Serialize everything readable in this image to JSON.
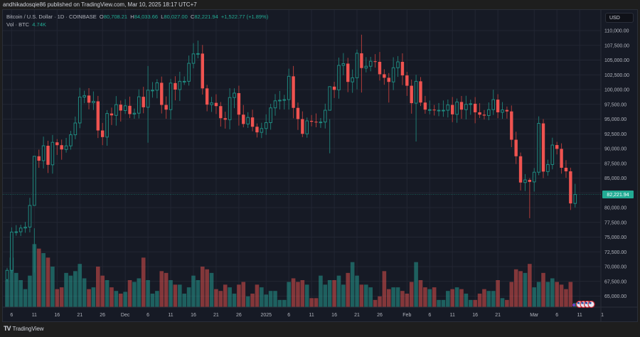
{
  "header": {
    "published": "andhikadosqie86 published on TradingView.com, Mar 10, 2025 18:17 UTC+7"
  },
  "legend": {
    "symbol": "Bitcoin / U.S. Dollar · 1D · COINBASE",
    "o_label": "O",
    "o": "80,708.21",
    "h_label": "H",
    "h": "84,033.66",
    "l_label": "L",
    "l": "80,027.00",
    "c_label": "C",
    "c": "82,221.94",
    "change": "+1,522.77 (+1.89%)",
    "vol_label": "Vol · BTC",
    "vol": "4.74K"
  },
  "currency_button": "USD",
  "last_price_label": "82,221.94",
  "footer": {
    "logo": "TradingView"
  },
  "colors": {
    "up": "#26a69a",
    "down": "#ef5350",
    "bg": "#161a25",
    "last": "#22ab94"
  },
  "price_ticks": [
    "110,000.00",
    "107,500.00",
    "105,000.00",
    "102,500.00",
    "100,000.00",
    "97,500.00",
    "95,000.00",
    "92,500.00",
    "90,000.00",
    "87,500.00",
    "85,000.00",
    "82,500.00",
    "80,000.00",
    "77,500.00",
    "75,000.00",
    "72,500.00",
    "70,000.00",
    "67,500.00",
    "65,000.00"
  ],
  "price_tick_values": [
    110000,
    107500,
    105000,
    102500,
    100000,
    97500,
    95000,
    92500,
    90000,
    87500,
    85000,
    82500,
    80000,
    77500,
    75000,
    72500,
    70000,
    67500,
    65000
  ],
  "time_labels": [
    {
      "text": "6",
      "day": 1
    },
    {
      "text": "11",
      "day": 6
    },
    {
      "text": "16",
      "day": 11
    },
    {
      "text": "21",
      "day": 16
    },
    {
      "text": "26",
      "day": 21
    },
    {
      "text": "Dec",
      "day": 26
    },
    {
      "text": "6",
      "day": 31
    },
    {
      "text": "11",
      "day": 36
    },
    {
      "text": "16",
      "day": 41
    },
    {
      "text": "21",
      "day": 46
    },
    {
      "text": "26",
      "day": 51
    },
    {
      "text": "2025",
      "day": 57
    },
    {
      "text": "6",
      "day": 62
    },
    {
      "text": "11",
      "day": 67
    },
    {
      "text": "16",
      "day": 72
    },
    {
      "text": "21",
      "day": 77
    },
    {
      "text": "26",
      "day": 82
    },
    {
      "text": "Feb",
      "day": 88
    },
    {
      "text": "6",
      "day": 93
    },
    {
      "text": "11",
      "day": 98
    },
    {
      "text": "16",
      "day": 103
    },
    {
      "text": "21",
      "day": 108
    },
    {
      "text": "Mar",
      "day": 116
    },
    {
      "text": "6",
      "day": 121
    },
    {
      "text": "11",
      "day": 126
    },
    {
      "text": "1",
      "day": 131
    }
  ],
  "chart_data": {
    "type": "candlestick",
    "title": "Bitcoin / U.S. Dollar · 1D · COINBASE",
    "start_date": "2024-11-05",
    "ylim": [
      62500,
      111500
    ],
    "closes": [
      69370,
      75860,
      75900,
      76540,
      76700,
      80370,
      88700,
      87950,
      90480,
      87250,
      91060,
      90580,
      89850,
      90460,
      92340,
      94340,
      98730,
      98990,
      97780,
      98010,
      93070,
      91950,
      95950,
      95630,
      97450,
      96450,
      97250,
      95850,
      96000,
      98780,
      97000,
      99900,
      99900,
      101150,
      97400,
      96600,
      101100,
      100000,
      101400,
      101400,
      104450,
      106050,
      106100,
      100200,
      97450,
      97750,
      97200,
      95150,
      94900,
      98650,
      99400,
      95750,
      94170,
      95280,
      93700,
      92750,
      93400,
      94400,
      96900,
      98100,
      98200,
      98300,
      102250,
      96900,
      95000,
      92500,
      94700,
      94550,
      94500,
      94500,
      96500,
      100500,
      99950,
      104100,
      104400,
      101300,
      102000,
      106150,
      103650,
      103950,
      104800,
      104700,
      102600,
      102000,
      101300,
      103700,
      104700,
      102400,
      100650,
      97700,
      101400,
      97800,
      96600,
      96600,
      96500,
      96500,
      96500,
      97400,
      95800,
      97900,
      96600,
      97500,
      97600,
      96150,
      95750,
      95600,
      96600,
      98300,
      96150,
      96550,
      96300,
      91500,
      88700,
      84250,
      84700,
      84350,
      86000,
      94270,
      86100,
      87300,
      90600,
      89950,
      86750,
      86150,
      80708,
      82221.94
    ],
    "first_open": 67800,
    "extremes": {
      "6": [
        76500,
        69000
      ],
      "31": [
        104000,
        91000
      ],
      "42": [
        108300,
        105300
      ],
      "71": [
        95000,
        89200
      ],
      "78": [
        109300,
        99500
      ],
      "84": [
        102800,
        97800
      ],
      "90": [
        102500,
        91200
      ],
      "115": [
        85000,
        78200
      ],
      "118": [
        95000,
        85000
      ],
      "125": [
        84033.66,
        80027
      ]
    },
    "volumes_k": [
      30,
      55,
      38,
      30,
      20,
      35,
      70,
      65,
      60,
      55,
      45,
      20,
      22,
      38,
      35,
      40,
      48,
      32,
      20,
      22,
      45,
      35,
      30,
      22,
      18,
      15,
      17,
      30,
      28,
      32,
      55,
      30,
      15,
      18,
      40,
      38,
      30,
      25,
      25,
      15,
      22,
      35,
      30,
      45,
      42,
      38,
      20,
      18,
      25,
      22,
      15,
      25,
      28,
      12,
      15,
      25,
      22,
      14,
      18,
      18,
      8,
      8,
      28,
      32,
      28,
      30,
      25,
      10,
      10,
      35,
      25,
      30,
      30,
      35,
      25,
      38,
      50,
      35,
      25,
      25,
      22,
      8,
      12,
      40,
      20,
      22,
      22,
      18,
      15,
      28,
      50,
      30,
      22,
      20,
      22,
      8,
      8,
      18,
      20,
      22,
      20,
      15,
      8,
      8,
      15,
      20,
      18,
      18,
      30,
      10,
      8,
      28,
      42,
      40,
      38,
      48,
      22,
      28,
      38,
      28,
      32,
      28,
      25,
      20,
      28,
      4.74
    ]
  }
}
